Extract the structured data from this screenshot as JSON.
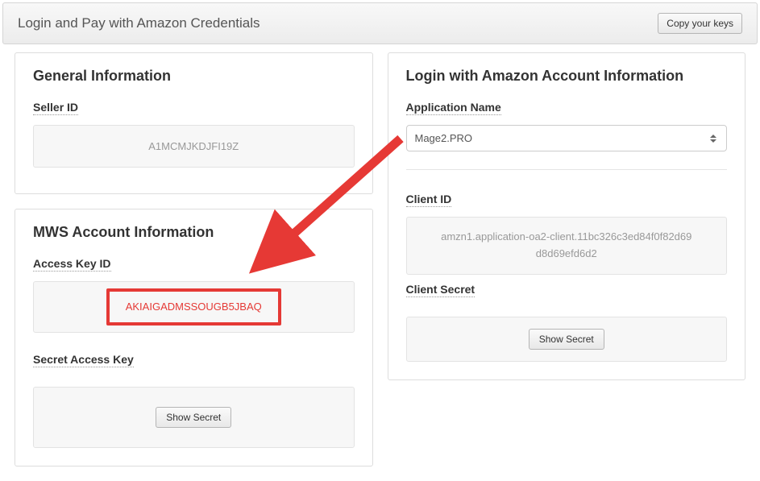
{
  "header": {
    "title": "Login and Pay with Amazon Credentials",
    "copy_button": "Copy your keys"
  },
  "general": {
    "heading": "General Information",
    "seller_id_label": "Seller ID",
    "seller_id_value": "A1MCMJKDJFI19Z"
  },
  "mws": {
    "heading": "MWS Account Information",
    "access_key_label": "Access Key ID",
    "access_key_value": "AKIAIGADMSSOUGB5JBAQ",
    "secret_label": "Secret Access Key",
    "show_secret_button": "Show Secret"
  },
  "login_info": {
    "heading": "Login with Amazon Account Information",
    "app_name_label": "Application Name",
    "app_name_value": "Mage2.PRO",
    "client_id_label": "Client ID",
    "client_id_value": "amzn1.application-oa2-client.11bc326c3ed84f0f82d69d8d69efd6d2",
    "client_secret_label": "Client Secret",
    "show_secret_button": "Show Secret"
  },
  "annotation": {
    "arrow_color": "#e63935",
    "highlight_color": "#e53935"
  }
}
